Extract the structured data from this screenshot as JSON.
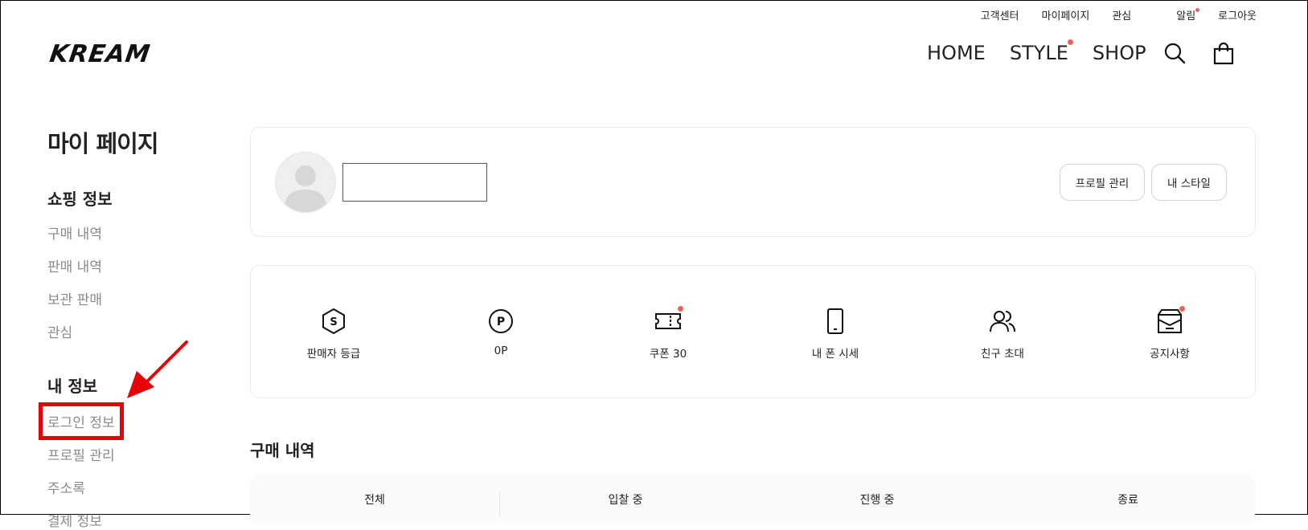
{
  "util_nav": [
    "고객센터",
    "마이페이지",
    "관심",
    "알림",
    "로그아웃"
  ],
  "logo": "KREAM",
  "main_nav": [
    "HOME",
    "STYLE",
    "SHOP"
  ],
  "sidebar": {
    "title": "마이 페이지",
    "shopping": {
      "heading": "쇼핑 정보",
      "items": [
        "구매 내역",
        "판매 내역",
        "보관 판매",
        "관심"
      ]
    },
    "my_info": {
      "heading": "내 정보",
      "items": [
        "로그인 정보",
        "프로필 관리",
        "주소록",
        "결제 정보"
      ]
    }
  },
  "profile": {
    "name_value": "",
    "buttons": [
      "프로필 관리",
      "내 스타일"
    ]
  },
  "stats": [
    {
      "label": "판매자 등급",
      "icon": "seller-grade-icon"
    },
    {
      "label": "0P",
      "icon": "points-icon"
    },
    {
      "label": "쿠폰 30",
      "icon": "coupon-icon"
    },
    {
      "label": "내 폰 시세",
      "icon": "phone-icon"
    },
    {
      "label": "친구 초대",
      "icon": "friends-icon"
    },
    {
      "label": "공지사항",
      "icon": "notice-icon"
    }
  ],
  "purchase": {
    "title": "구매 내역",
    "tabs": [
      "전체",
      "입찰 중",
      "진행 중",
      "종료"
    ]
  },
  "colors": {
    "accent_dot": "#ef6253",
    "highlight": "#e8000b"
  }
}
